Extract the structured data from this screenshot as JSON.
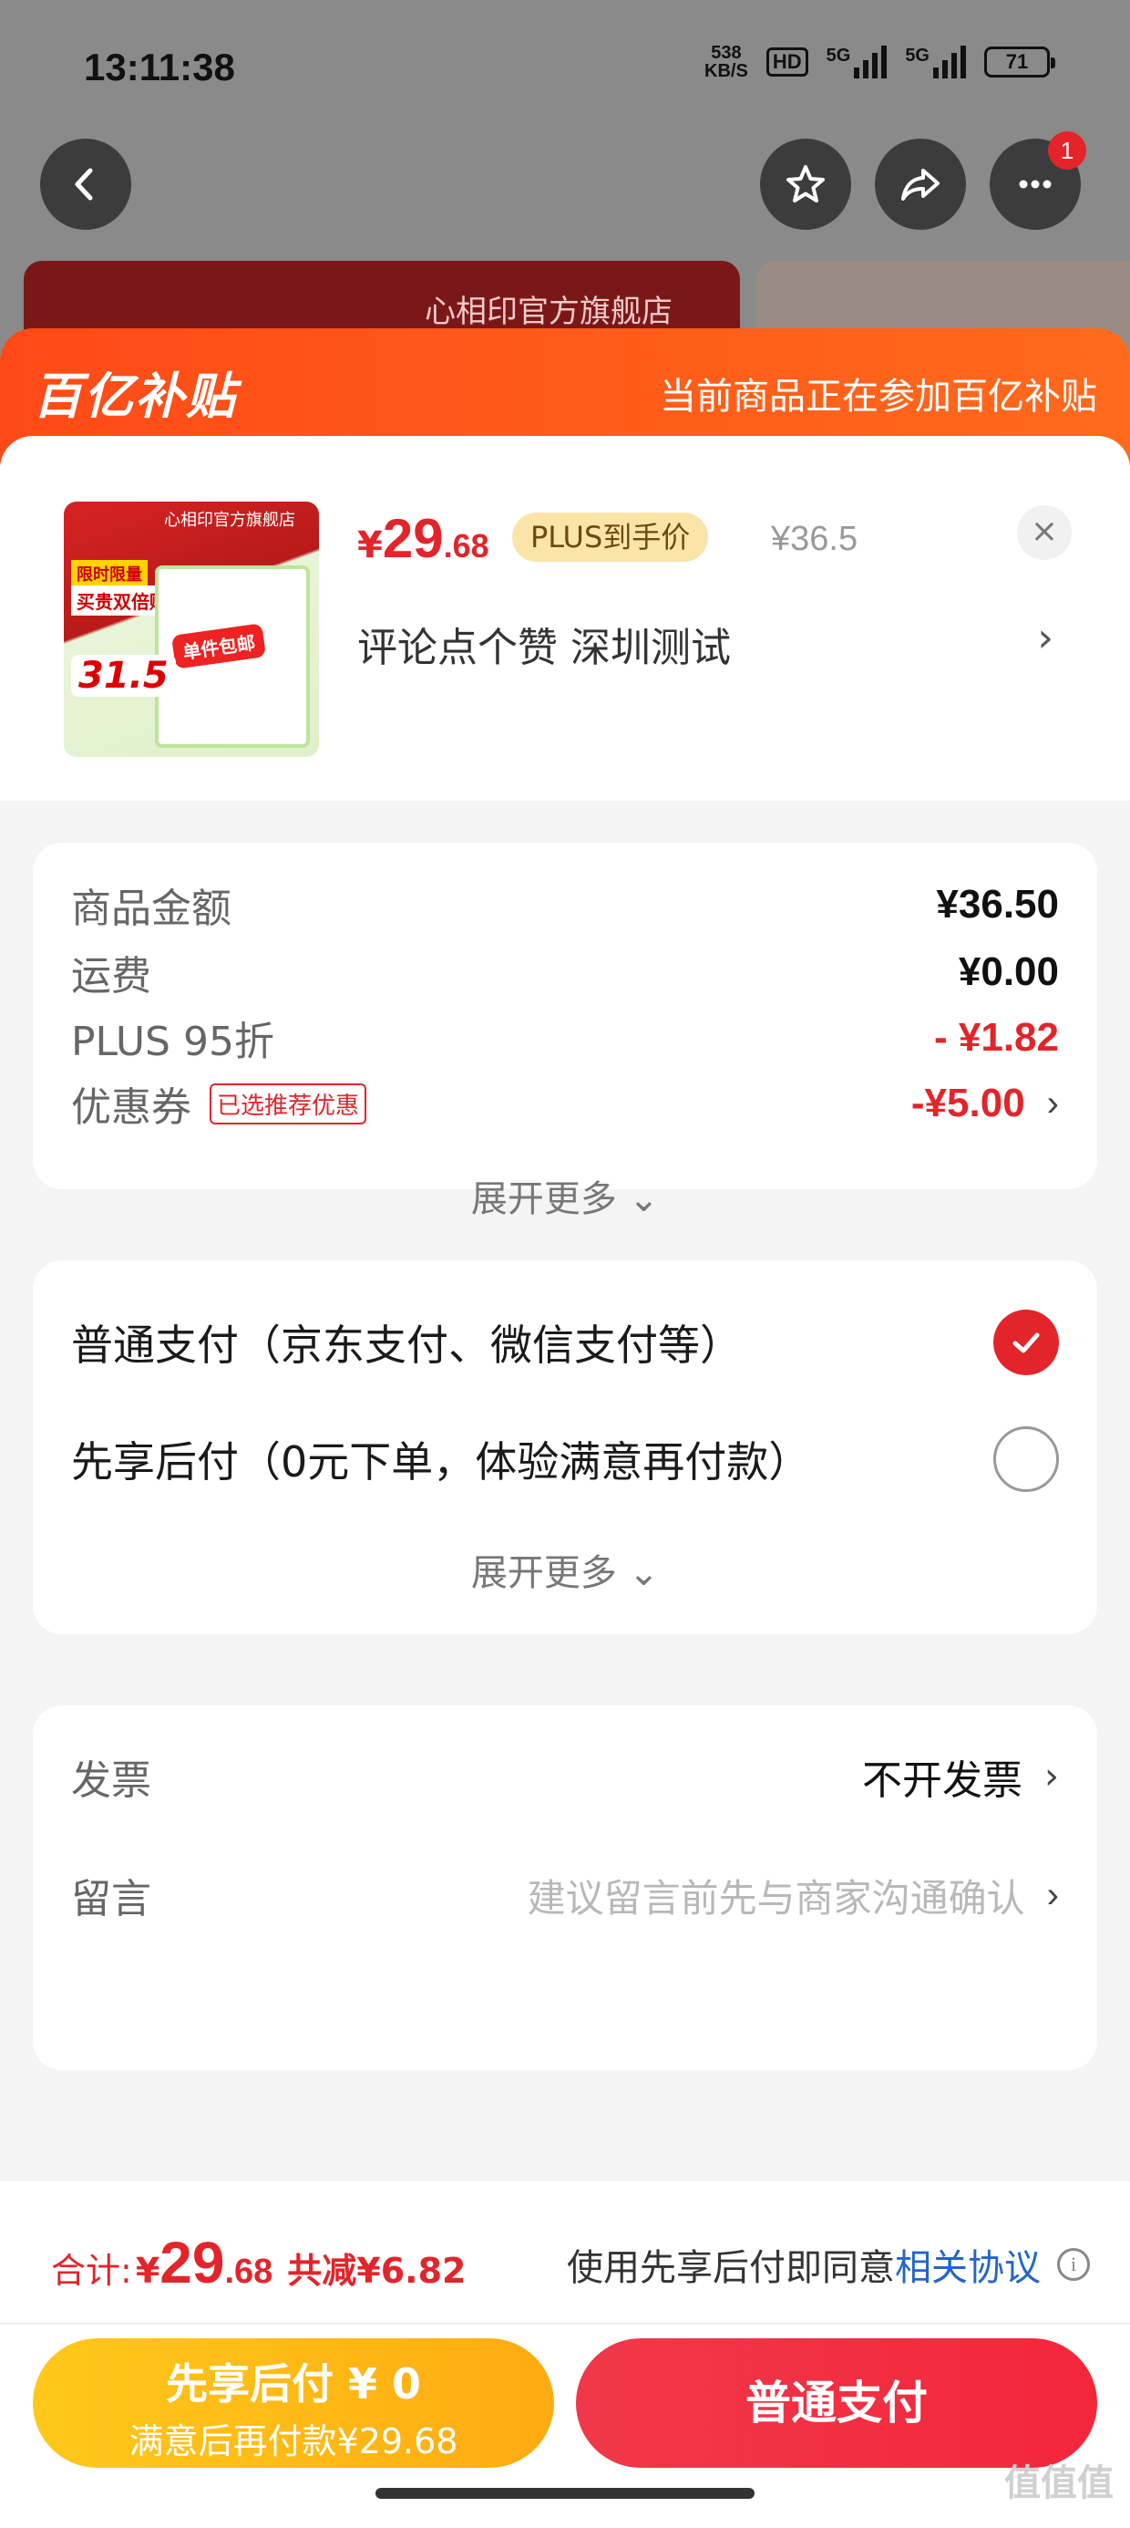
{
  "status_bar": {
    "time": "13:11:38",
    "net_speed_top": "538",
    "net_speed_bottom": "KB/S",
    "hd": "HD",
    "signal1": "5G",
    "signal2": "5G",
    "battery": "71"
  },
  "nav": {
    "back_icon": "chevron-left",
    "star_icon": "star",
    "share_icon": "share-arrow",
    "more_icon": "more-dots",
    "more_badge": "1"
  },
  "banner": {
    "store_name": "心相印官方旗舰店"
  },
  "sheet_header": {
    "logo": "百亿补贴",
    "note": "当前商品正在参加百亿补贴"
  },
  "product": {
    "currency": "¥",
    "price_int": "29",
    "price_dec": ".68",
    "plus_tag": "PLUS到手价",
    "original_price": "¥36.5",
    "close": "×",
    "spec": "评论点个赞  深圳测试",
    "spec_chevron": "›",
    "image": {
      "brand": "心相印官方旗舰店",
      "tag1": "限时限量",
      "tag2": "买贵双倍赔",
      "price": "31.5",
      "stamp": "单件包邮"
    }
  },
  "summary": {
    "rows": [
      {
        "label": "商品金额",
        "value": "¥36.50"
      },
      {
        "label": "运费",
        "value": "¥0.00"
      },
      {
        "label": "PLUS 95折",
        "value": "- ¥1.82"
      },
      {
        "label": "优惠券",
        "tag": "已选推荐优惠",
        "value": "-¥5.00",
        "chevron": "›"
      }
    ],
    "expand": "展开更多 ⌄"
  },
  "payment": {
    "options": [
      {
        "label": "普通支付（京东支付、微信支付等）",
        "selected": true
      },
      {
        "label": "先享后付（0元下单，体验满意再付款）",
        "selected": false
      }
    ],
    "expand": "展开更多 ⌄"
  },
  "extras": {
    "invoice_label": "发票",
    "invoice_value": "不开发票",
    "note_label": "留言",
    "note_placeholder": "建议留言前先与商家沟通确认",
    "chevron": "›"
  },
  "footer": {
    "total_label": "合计:",
    "total_cur": "¥",
    "total_int": "29",
    "total_dec": ".68",
    "saved": "共减¥6.82",
    "agree_text": "使用先享后付即同意",
    "agree_link": "相关协议",
    "info": "i",
    "btn_later_line1": "先享后付 ¥ 0",
    "btn_later_line2": "满意后再付款¥29.68",
    "btn_normal": "普通支付"
  },
  "watermark": "值值值",
  "colors": {
    "accent_red": "#e3242b",
    "subsidy_orange": "#ff5a1a",
    "later_yellow": "#ffb814",
    "link_blue": "#2366c9"
  }
}
